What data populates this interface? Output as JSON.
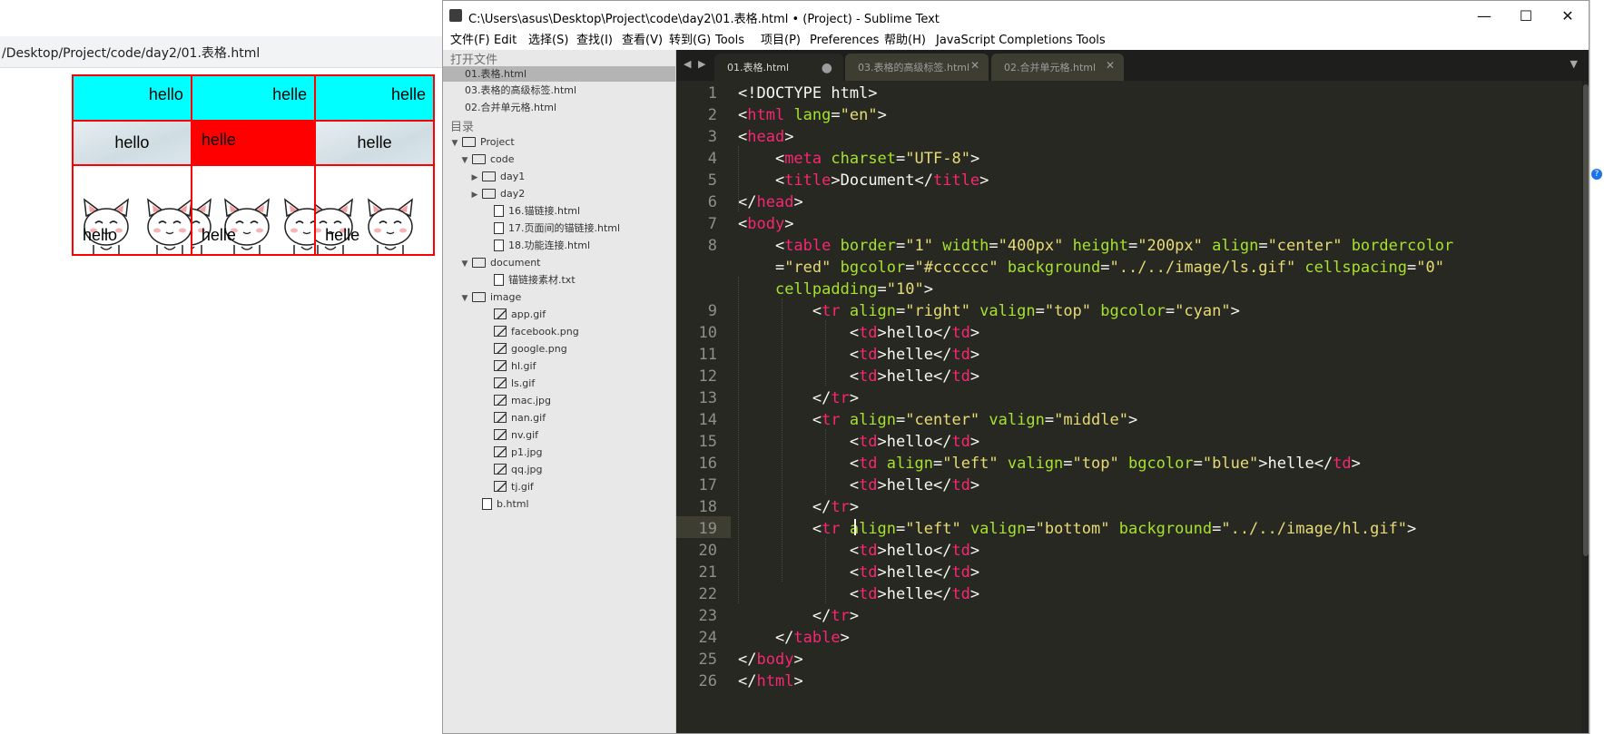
{
  "browser": {
    "url": "/Desktop/Project/code/day2/01.表格.html",
    "table": {
      "row1": [
        "hello",
        "helle",
        "helle"
      ],
      "row2": [
        "hello",
        "helle",
        "helle"
      ],
      "row3": [
        "hello",
        "helle",
        "helle"
      ]
    },
    "colors": {
      "row1_bg": "#00ffff",
      "highlight_cell": "#ff0000",
      "border": "#ff0000"
    }
  },
  "window": {
    "title": "C:\\Users\\asus\\Desktop\\Project\\code\\day2\\01.表格.html • (Project) - Sublime Text",
    "minimize": "—",
    "maximize": "☐",
    "close": "✕"
  },
  "menu": [
    "文件(F)",
    "Edit",
    "选择(S)",
    "查找(I)",
    "查看(V)",
    "转到(G)",
    "Tools",
    "项目(P)",
    "Preferences",
    "帮助(H)",
    "JavaScript Completions Tools"
  ],
  "sidebar": {
    "open_files_header": "打开文件",
    "open_files": [
      "01.表格.html",
      "03.表格的高级标签.html",
      "02.合并单元格.html"
    ],
    "folders_header": "目录",
    "tree": [
      {
        "label": "Project",
        "type": "folder",
        "state": "open"
      },
      {
        "label": "code",
        "type": "folder",
        "state": "open"
      },
      {
        "label": "day1",
        "type": "folder",
        "state": "closed"
      },
      {
        "label": "day2",
        "type": "folder",
        "state": "closed"
      },
      {
        "label": "16.锚链接.html",
        "type": "file"
      },
      {
        "label": "17.页面间的锚链接.html",
        "type": "file"
      },
      {
        "label": "18.功能连接.html",
        "type": "file"
      },
      {
        "label": "document",
        "type": "folder",
        "state": "open"
      },
      {
        "label": "锚链接素材.txt",
        "type": "file"
      },
      {
        "label": "image",
        "type": "folder",
        "state": "open"
      },
      {
        "label": "app.gif",
        "type": "image"
      },
      {
        "label": "facebook.png",
        "type": "image"
      },
      {
        "label": "google.png",
        "type": "image"
      },
      {
        "label": "hl.gif",
        "type": "image"
      },
      {
        "label": "ls.gif",
        "type": "image"
      },
      {
        "label": "mac.jpg",
        "type": "image"
      },
      {
        "label": "nan.gif",
        "type": "image"
      },
      {
        "label": "nv.gif",
        "type": "image"
      },
      {
        "label": "p1.jpg",
        "type": "image"
      },
      {
        "label": "qq.jpg",
        "type": "image"
      },
      {
        "label": "tj.gif",
        "type": "image"
      },
      {
        "label": "b.html",
        "type": "file"
      }
    ]
  },
  "tabs": [
    {
      "label": "01.表格.html",
      "active": true,
      "dirty": true
    },
    {
      "label": "03.表格的高级标签.html",
      "active": false
    },
    {
      "label": "02.合并单元格.html",
      "active": false
    }
  ],
  "editor": {
    "active_line": 19,
    "lines": [
      {
        "n": "1",
        "tokens": [
          [
            "p",
            "<!DOCTYPE html>"
          ]
        ]
      },
      {
        "n": "2",
        "tokens": [
          [
            "p",
            "<"
          ],
          [
            "t",
            "html"
          ],
          [
            "a",
            " lang"
          ],
          [
            "p",
            "="
          ],
          [
            "s",
            "\"en\""
          ],
          [
            "p",
            ">"
          ]
        ]
      },
      {
        "n": "3",
        "tokens": [
          [
            "p",
            "<"
          ],
          [
            "t",
            "head"
          ],
          [
            "p",
            ">"
          ]
        ]
      },
      {
        "n": "4",
        "tokens": [
          [
            "p",
            "    <"
          ],
          [
            "t",
            "meta"
          ],
          [
            "a",
            " charset"
          ],
          [
            "p",
            "="
          ],
          [
            "s",
            "\"UTF-8\""
          ],
          [
            "p",
            ">"
          ]
        ]
      },
      {
        "n": "5",
        "tokens": [
          [
            "p",
            "    <"
          ],
          [
            "t",
            "title"
          ],
          [
            "p",
            ">Document</"
          ],
          [
            "t",
            "title"
          ],
          [
            "p",
            ">"
          ]
        ]
      },
      {
        "n": "6",
        "tokens": [
          [
            "p",
            "</"
          ],
          [
            "t",
            "head"
          ],
          [
            "p",
            ">"
          ]
        ]
      },
      {
        "n": "7",
        "tokens": [
          [
            "p",
            "<"
          ],
          [
            "t",
            "body"
          ],
          [
            "p",
            ">"
          ]
        ]
      },
      {
        "n": "8",
        "tokens": [
          [
            "p",
            "    <"
          ],
          [
            "t",
            "table"
          ],
          [
            "a",
            " border"
          ],
          [
            "p",
            "="
          ],
          [
            "s",
            "\"1\""
          ],
          [
            "a",
            " width"
          ],
          [
            "p",
            "="
          ],
          [
            "s",
            "\"400px\""
          ],
          [
            "a",
            " height"
          ],
          [
            "p",
            "="
          ],
          [
            "s",
            "\"200px\""
          ],
          [
            "a",
            " align"
          ],
          [
            "p",
            "="
          ],
          [
            "s",
            "\"center\""
          ],
          [
            "a",
            " bordercolor"
          ]
        ]
      },
      {
        "n": "",
        "tokens": [
          [
            "p",
            "    ="
          ],
          [
            "s",
            "\"red\""
          ],
          [
            "a",
            " bgcolor"
          ],
          [
            "p",
            "="
          ],
          [
            "s",
            "\"#cccccc\""
          ],
          [
            "a",
            " background"
          ],
          [
            "p",
            "="
          ],
          [
            "s",
            "\"../../image/ls.gif\""
          ],
          [
            "a",
            " cellspacing"
          ],
          [
            "p",
            "="
          ],
          [
            "s",
            "\"0\""
          ]
        ]
      },
      {
        "n": "",
        "tokens": [
          [
            "p",
            "    "
          ],
          [
            "a",
            "cellpadding"
          ],
          [
            "p",
            "="
          ],
          [
            "s",
            "\"10\""
          ],
          [
            "p",
            ">"
          ]
        ]
      },
      {
        "n": "9",
        "tokens": [
          [
            "p",
            "        <"
          ],
          [
            "t",
            "tr"
          ],
          [
            "a",
            " align"
          ],
          [
            "p",
            "="
          ],
          [
            "s",
            "\"right\""
          ],
          [
            "a",
            " valign"
          ],
          [
            "p",
            "="
          ],
          [
            "s",
            "\"top\""
          ],
          [
            "a",
            " bgcolor"
          ],
          [
            "p",
            "="
          ],
          [
            "s",
            "\"cyan\""
          ],
          [
            "p",
            ">"
          ]
        ]
      },
      {
        "n": "10",
        "tokens": [
          [
            "p",
            "            <"
          ],
          [
            "t",
            "td"
          ],
          [
            "p",
            ">hello</"
          ],
          [
            "t",
            "td"
          ],
          [
            "p",
            ">"
          ]
        ]
      },
      {
        "n": "11",
        "tokens": [
          [
            "p",
            "            <"
          ],
          [
            "t",
            "td"
          ],
          [
            "p",
            ">helle</"
          ],
          [
            "t",
            "td"
          ],
          [
            "p",
            ">"
          ]
        ]
      },
      {
        "n": "12",
        "tokens": [
          [
            "p",
            "            <"
          ],
          [
            "t",
            "td"
          ],
          [
            "p",
            ">helle</"
          ],
          [
            "t",
            "td"
          ],
          [
            "p",
            ">"
          ]
        ]
      },
      {
        "n": "13",
        "tokens": [
          [
            "p",
            "        </"
          ],
          [
            "t",
            "tr"
          ],
          [
            "p",
            ">"
          ]
        ]
      },
      {
        "n": "14",
        "tokens": [
          [
            "p",
            "        <"
          ],
          [
            "t",
            "tr"
          ],
          [
            "a",
            " align"
          ],
          [
            "p",
            "="
          ],
          [
            "s",
            "\"center\""
          ],
          [
            "a",
            " valign"
          ],
          [
            "p",
            "="
          ],
          [
            "s",
            "\"middle\""
          ],
          [
            "p",
            ">"
          ]
        ]
      },
      {
        "n": "15",
        "tokens": [
          [
            "p",
            "            <"
          ],
          [
            "t",
            "td"
          ],
          [
            "p",
            ">hello</"
          ],
          [
            "t",
            "td"
          ],
          [
            "p",
            ">"
          ]
        ]
      },
      {
        "n": "16",
        "tokens": [
          [
            "p",
            "            <"
          ],
          [
            "t",
            "td"
          ],
          [
            "a",
            " align"
          ],
          [
            "p",
            "="
          ],
          [
            "s",
            "\"left\""
          ],
          [
            "a",
            " valign"
          ],
          [
            "p",
            "="
          ],
          [
            "s",
            "\"top\""
          ],
          [
            "a",
            " bgcolor"
          ],
          [
            "p",
            "="
          ],
          [
            "s",
            "\"blue\""
          ],
          [
            "p",
            ">helle</"
          ],
          [
            "t",
            "td"
          ],
          [
            "p",
            ">"
          ]
        ]
      },
      {
        "n": "17",
        "tokens": [
          [
            "p",
            "            <"
          ],
          [
            "t",
            "td"
          ],
          [
            "p",
            ">helle</"
          ],
          [
            "t",
            "td"
          ],
          [
            "p",
            ">"
          ]
        ]
      },
      {
        "n": "18",
        "tokens": [
          [
            "p",
            "        </"
          ],
          [
            "t",
            "tr"
          ],
          [
            "p",
            ">"
          ]
        ]
      },
      {
        "n": "19",
        "tokens": [
          [
            "p",
            "        <"
          ],
          [
            "t",
            "tr"
          ],
          [
            "a",
            " align"
          ],
          [
            "p",
            "="
          ],
          [
            "s",
            "\"left\""
          ],
          [
            "a",
            " valign"
          ],
          [
            "p",
            "="
          ],
          [
            "s",
            "\"bottom\""
          ],
          [
            "a",
            " background"
          ],
          [
            "p",
            "="
          ],
          [
            "s",
            "\"../../image/hl.gif\""
          ],
          [
            "p",
            ">"
          ]
        ]
      },
      {
        "n": "20",
        "tokens": [
          [
            "p",
            "            <"
          ],
          [
            "t",
            "td"
          ],
          [
            "p",
            ">hello</"
          ],
          [
            "t",
            "td"
          ],
          [
            "p",
            ">"
          ]
        ]
      },
      {
        "n": "21",
        "tokens": [
          [
            "p",
            "            <"
          ],
          [
            "t",
            "td"
          ],
          [
            "p",
            ">helle</"
          ],
          [
            "t",
            "td"
          ],
          [
            "p",
            ">"
          ]
        ]
      },
      {
        "n": "22",
        "tokens": [
          [
            "p",
            "            <"
          ],
          [
            "t",
            "td"
          ],
          [
            "p",
            ">helle</"
          ],
          [
            "t",
            "td"
          ],
          [
            "p",
            ">"
          ]
        ]
      },
      {
        "n": "23",
        "tokens": [
          [
            "p",
            "        </"
          ],
          [
            "t",
            "tr"
          ],
          [
            "p",
            ">"
          ]
        ]
      },
      {
        "n": "24",
        "tokens": [
          [
            "p",
            "    </"
          ],
          [
            "t",
            "table"
          ],
          [
            "p",
            ">"
          ]
        ]
      },
      {
        "n": "25",
        "tokens": [
          [
            "p",
            "</"
          ],
          [
            "t",
            "body"
          ],
          [
            "p",
            ">"
          ]
        ]
      },
      {
        "n": "26",
        "tokens": [
          [
            "p",
            "</"
          ],
          [
            "t",
            "html"
          ],
          [
            "p",
            ">"
          ]
        ]
      }
    ],
    "colors": {
      "background": "#272822",
      "tag": "#f92672",
      "attr": "#a6e22e",
      "string": "#e6db74",
      "text": "#f8f8f2",
      "gutter": "#90908a"
    }
  },
  "right_strip": {
    "badge": "?"
  }
}
